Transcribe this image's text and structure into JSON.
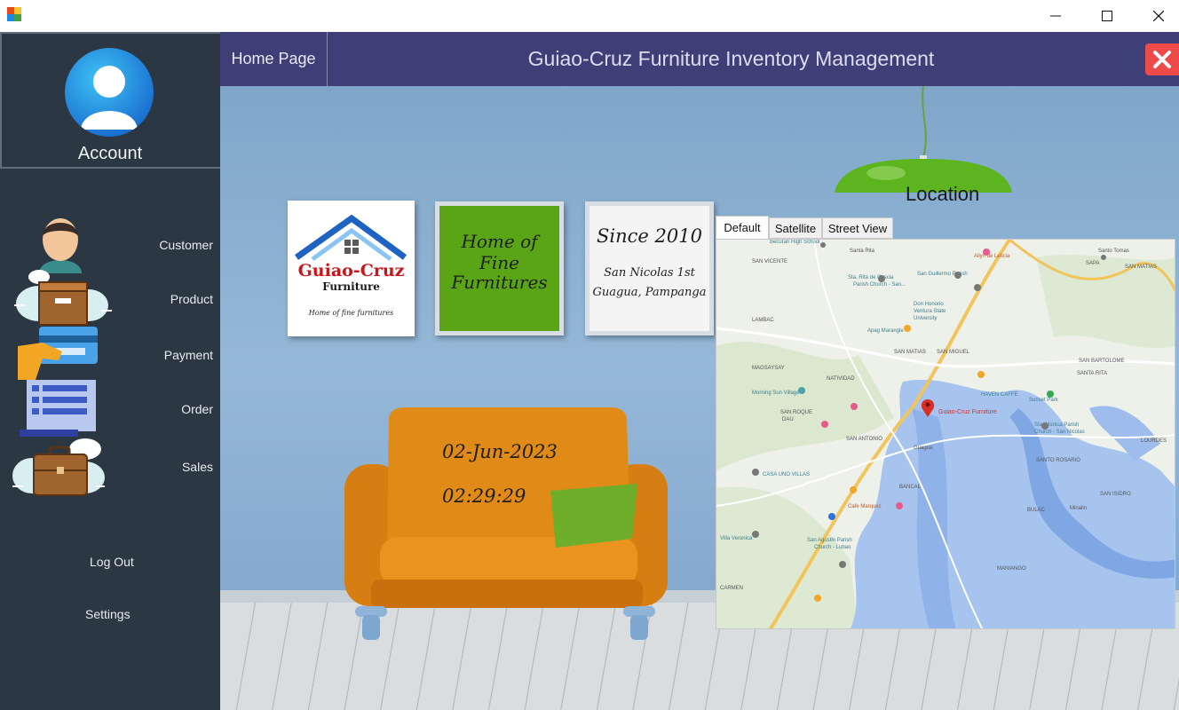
{
  "window": {
    "app_icon": "app-icon",
    "controls": [
      "minimize-icon",
      "maximize-icon",
      "close-icon"
    ]
  },
  "sidebar": {
    "account_label": "Account",
    "items": [
      {
        "label": "Customer",
        "icon": "customer-icon"
      },
      {
        "label": "Product",
        "icon": "product-box-icon"
      },
      {
        "label": "Payment",
        "icon": "credit-card-icon"
      },
      {
        "label": "Order",
        "icon": "order-list-icon"
      },
      {
        "label": "Sales",
        "icon": "briefcase-icon"
      }
    ],
    "logout_label": "Log Out",
    "settings_label": "Settings"
  },
  "header": {
    "home_tab": "Home Page",
    "title": "Guiao-Cruz Furniture Inventory Management"
  },
  "frames": {
    "logo_name": "Guiao-Cruz",
    "logo_sub": "Furniture",
    "logo_tagline": "Home of fine furnitures",
    "green_line1": "Home of Fine",
    "green_line2": "Furnitures",
    "since": "Since 2010",
    "address_line1": "San Nicolas 1st",
    "address_line2": "Guagua, Pampanga"
  },
  "datetime": {
    "date": "02-Jun-2023",
    "time": "02:29:29"
  },
  "location_label": "Location",
  "map": {
    "tabs": [
      "Default",
      "Satellite",
      "Street View"
    ],
    "selected_tab": "Default",
    "places": [
      {
        "name": "Guiao-Cruz Furniture",
        "color": "#d93025"
      },
      {
        "name": "Guagua"
      },
      {
        "name": "SAN ANTONIO"
      },
      {
        "name": "SAN MATIAS"
      },
      {
        "name": "SAN MIGUEL"
      },
      {
        "name": "SAN VICENTE"
      },
      {
        "name": "SANTA RITA"
      },
      {
        "name": "SAN BARTOLOME"
      },
      {
        "name": "SANTO ROSARIO"
      },
      {
        "name": "SAN ISIDRO"
      },
      {
        "name": "MAGSAYSAY"
      },
      {
        "name": "NATIVIDAD"
      },
      {
        "name": "LAMBAC"
      },
      {
        "name": "BANCAL"
      },
      {
        "name": "BULAC"
      },
      {
        "name": "MANIANGO"
      },
      {
        "name": "CARMEN"
      },
      {
        "name": "LOURDES"
      },
      {
        "name": "Minalin"
      },
      {
        "name": "Santa Rita"
      },
      {
        "name": "SAPA"
      },
      {
        "name": "Santo Tomas"
      },
      {
        "name": "HAVEN CAFFE"
      },
      {
        "name": "Sunset Park"
      },
      {
        "name": "Morning Sun Village"
      },
      {
        "name": "CASA UNO VILLAS"
      },
      {
        "name": "Villa Veronica"
      },
      {
        "name": "Apag Marangle"
      },
      {
        "name": "Don Honorio Ventura State University"
      },
      {
        "name": "Sta. Monica Parish Church - San Nicolas"
      },
      {
        "name": "Sta. Rita de Cascia Parish Church - San..."
      },
      {
        "name": "San Guillermo Parish Church"
      },
      {
        "name": "San Agustin Parish Church - Lubao"
      },
      {
        "name": "Becuran High School"
      },
      {
        "name": "Ailyn de Leticia"
      },
      {
        "name": "Cafe Marquez"
      }
    ]
  },
  "colors": {
    "sidebar": "#2b3742",
    "header": "#3f3f78",
    "close_button": "#ee4a4a",
    "wall": "#8fb3d4",
    "sofa": "#e08a17",
    "pillow": "#6fae2a",
    "lamp": "#5cb51f",
    "green_frame": "#5aa516"
  }
}
